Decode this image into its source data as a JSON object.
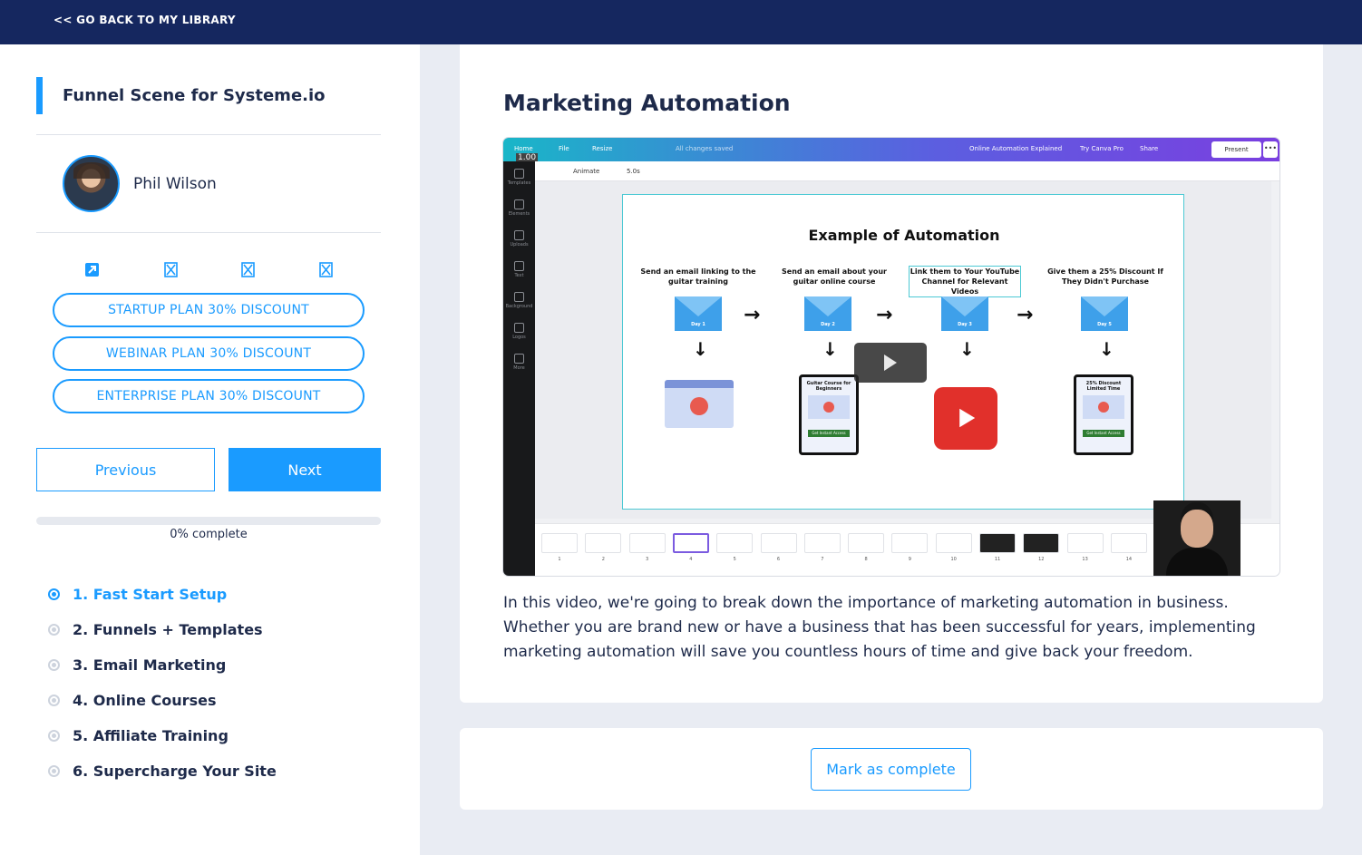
{
  "topbar": {
    "back_label": "<< GO BACK TO MY LIBRARY"
  },
  "sidebar": {
    "course_title": "Funnel Scene for Systeme.io",
    "author_name": "Phil Wilson",
    "social_icons": [
      "external-link-icon",
      "broken-image-icon",
      "broken-image-icon",
      "broken-image-icon"
    ],
    "plans": [
      "STARTUP PLAN 30% DISCOUNT",
      "WEBINAR PLAN 30% DISCOUNT",
      "ENTERPRISE PLAN 30% DISCOUNT"
    ],
    "previous_label": "Previous",
    "next_label": "Next",
    "progress_percent": 0,
    "progress_label": "0% complete",
    "modules": [
      {
        "label": "1. Fast Start Setup",
        "active": true
      },
      {
        "label": "2. Funnels + Templates",
        "active": false
      },
      {
        "label": "3. Email Marketing",
        "active": false
      },
      {
        "label": "4. Online Courses",
        "active": false
      },
      {
        "label": "5. Affiliate Training",
        "active": false
      },
      {
        "label": "6. Supercharge Your Site",
        "active": false
      }
    ]
  },
  "lesson": {
    "title": "Marketing Automation",
    "description": "In this video, we're going to break down the importance of marketing automation in business. Whether you are brand new or have a business that has been successful for years, implementing marketing automation will save you countless hours of time and give back your freedom.",
    "video": {
      "toolbar": {
        "home": "Home",
        "file": "File",
        "resize": "Resize",
        "saved": "All changes saved",
        "doc_title": "Online Automation Explained",
        "try_pro": "Try Canva Pro",
        "share": "Share",
        "present": "Present",
        "animate": "Animate",
        "duration": "5.0s",
        "zoom_badge": "1.00"
      },
      "side_items": [
        "Templates",
        "Elements",
        "Uploads",
        "Text",
        "Background",
        "Logos",
        "More"
      ],
      "slide_title": "Example of Automation",
      "steps": [
        "Send an email linking to the guitar training",
        "Send an email about your guitar online course",
        "Link them to Your YouTube Channel for Relevant Videos",
        "Give them a 25% Discount If They Didn't Purchase"
      ],
      "day_labels": [
        "Day 1",
        "Day 2",
        "Day 3",
        "Day 5"
      ],
      "phone_titles": [
        "Guitar Course for Beginners",
        "25% Discount Limited Time"
      ],
      "phone_button": "Get Instant Access",
      "thumb_numbers": [
        "1",
        "2",
        "3",
        "4",
        "5",
        "6",
        "7",
        "8",
        "9",
        "10",
        "11",
        "12",
        "13",
        "14"
      ]
    }
  },
  "complete": {
    "label": "Mark as complete"
  }
}
